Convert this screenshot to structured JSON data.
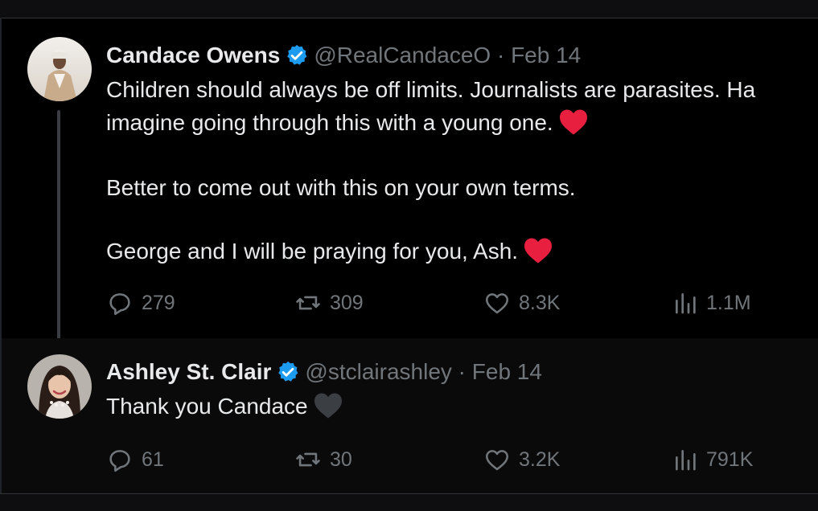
{
  "tweets": [
    {
      "author_name": "Candace Owens",
      "handle": "@RealCandaceO",
      "separator": "·",
      "date": "Feb 14",
      "lines": [
        "Children should always be off limits. Journalists are parasites. Ha",
        "imagine going through this with a young one.",
        "Better to come out with this on your own terms.",
        "George and I will be praying for you, Ash."
      ],
      "emoji_color": "#e81f3f",
      "stats": {
        "replies": "279",
        "reposts": "309",
        "likes": "8.3K",
        "views": "1.1M"
      }
    },
    {
      "author_name": "Ashley St. Clair",
      "handle": "@stclairashley",
      "separator": "·",
      "date": "Feb 14",
      "lines": [
        "Thank you Candace"
      ],
      "emoji_color": "#3b3e42",
      "stats": {
        "replies": "61",
        "reposts": "30",
        "likes": "3.2K",
        "views": "791K"
      }
    }
  ],
  "icons": {
    "verified": "verified-badge-icon",
    "reply": "reply-icon",
    "repost": "repost-icon",
    "like": "like-icon",
    "views": "views-icon",
    "heart_emoji": "heart-emoji-icon"
  },
  "colors": {
    "verified": "#1d9bf0",
    "muted": "#71767b",
    "text": "#e7e9ea",
    "background": "#000000"
  }
}
